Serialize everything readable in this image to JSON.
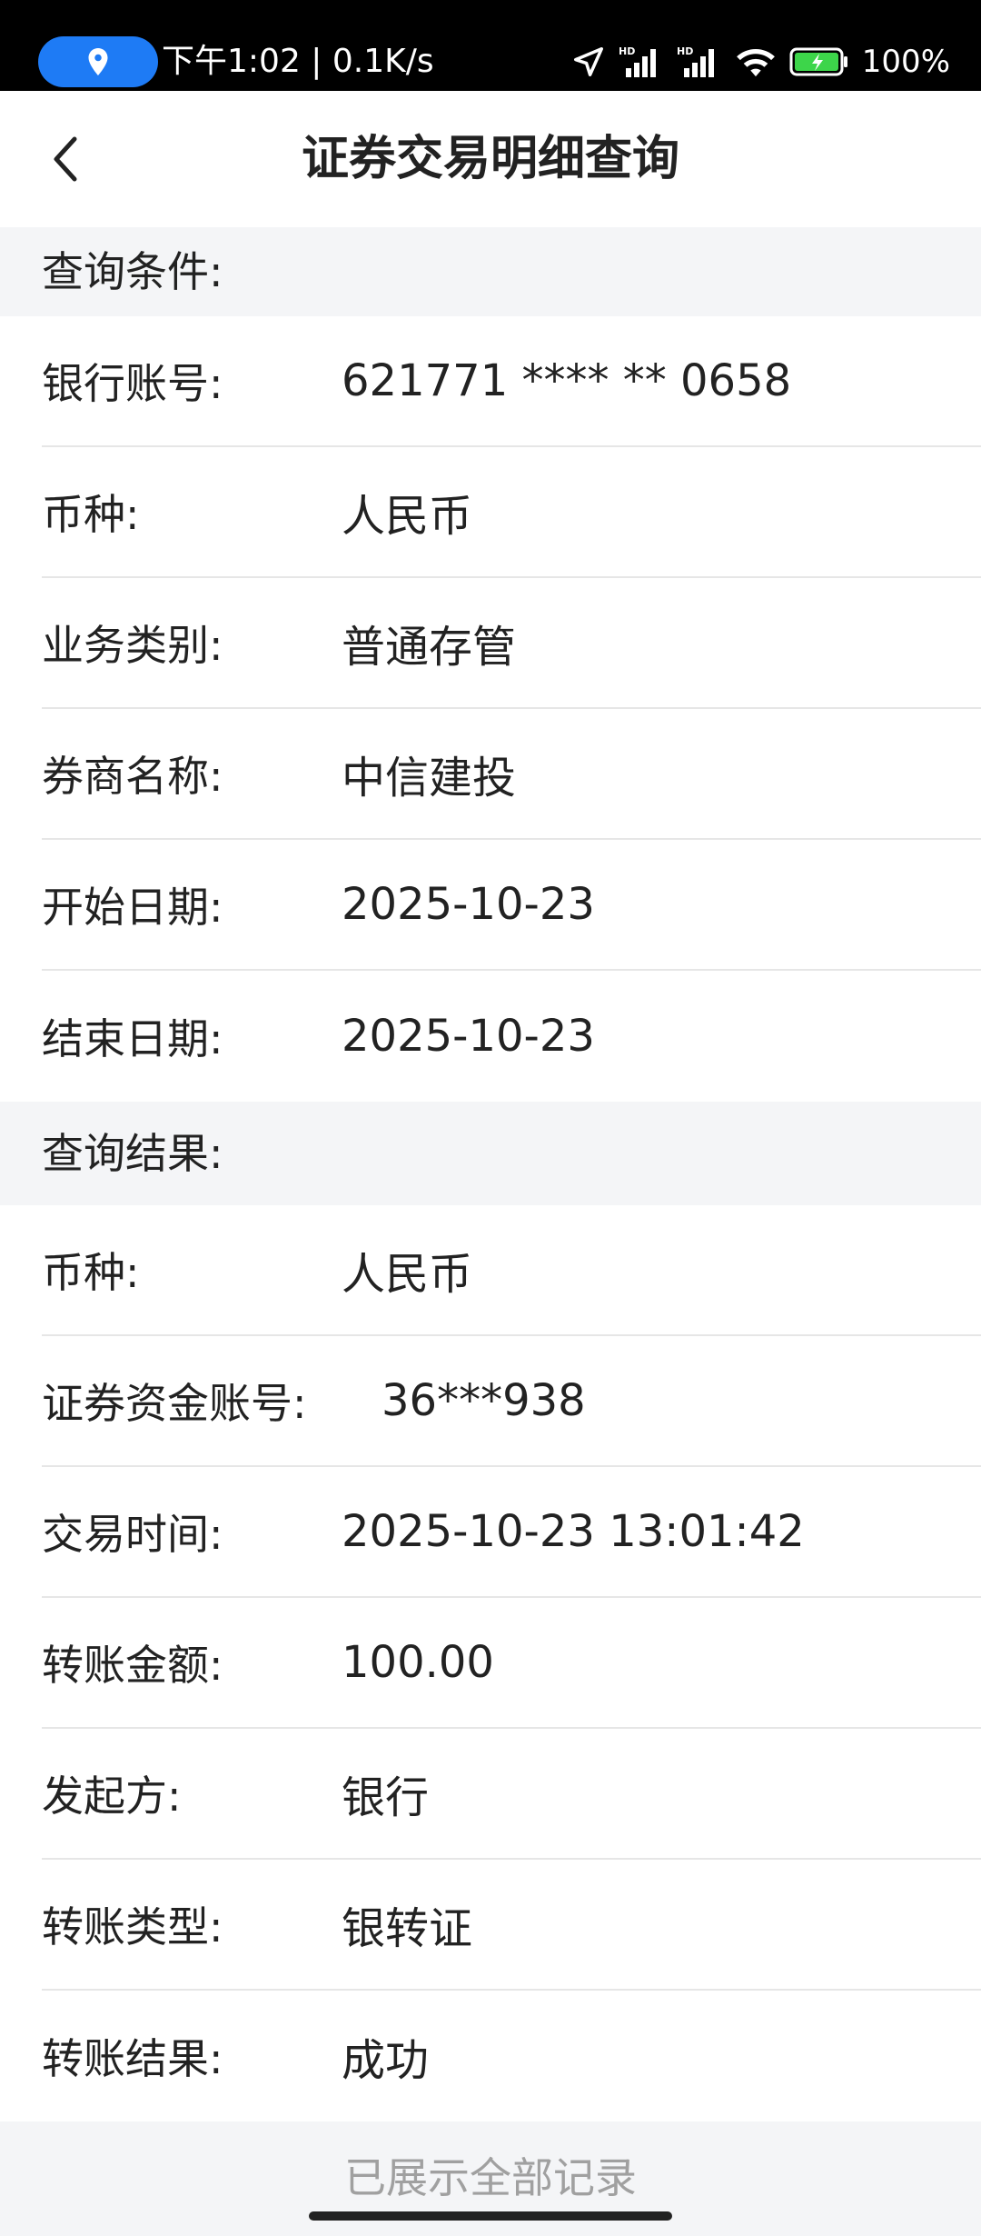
{
  "status_bar": {
    "time_speed": "下午1:02 | 0.1K/s",
    "battery_pct": "100%",
    "icons": [
      "location-icon",
      "navigation-arrow-icon",
      "signal-hd-icon",
      "signal-hd-icon",
      "wifi-icon",
      "battery-charging-icon"
    ]
  },
  "navbar": {
    "title": "证券交易明细查询",
    "back_icon": "chevron-left-icon"
  },
  "query_conditions": {
    "header": "查询条件:",
    "rows": [
      {
        "label": "银行账号:",
        "value": "621771 **** ** 0658"
      },
      {
        "label": "币种:",
        "value": "人民币"
      },
      {
        "label": "业务类别:",
        "value": "普通存管"
      },
      {
        "label": "券商名称:",
        "value": "中信建投"
      },
      {
        "label": "开始日期:",
        "value": "2025-10-23"
      },
      {
        "label": "结束日期:",
        "value": "2025-10-23"
      }
    ]
  },
  "query_results": {
    "header": "查询结果:",
    "rows": [
      {
        "label": "币种:",
        "value": "人民币"
      },
      {
        "label": "证券资金账号:",
        "value": "36***938"
      },
      {
        "label": "交易时间:",
        "value": "2025-10-23 13:01:42"
      },
      {
        "label": "转账金额:",
        "value": "100.00"
      },
      {
        "label": "发起方:",
        "value": "银行"
      },
      {
        "label": "转账类型:",
        "value": "银转证"
      },
      {
        "label": "转账结果:",
        "value": "成功"
      }
    ]
  },
  "footer": {
    "text": "已展示全部记录"
  },
  "colors": {
    "status_bar_bg": "#000000",
    "location_pill": "#1e7bf5",
    "battery_fill": "#3dd54a",
    "page_bg": "#f4f5f7",
    "card_bg": "#ffffff",
    "footer_text": "#a0a0a0"
  }
}
